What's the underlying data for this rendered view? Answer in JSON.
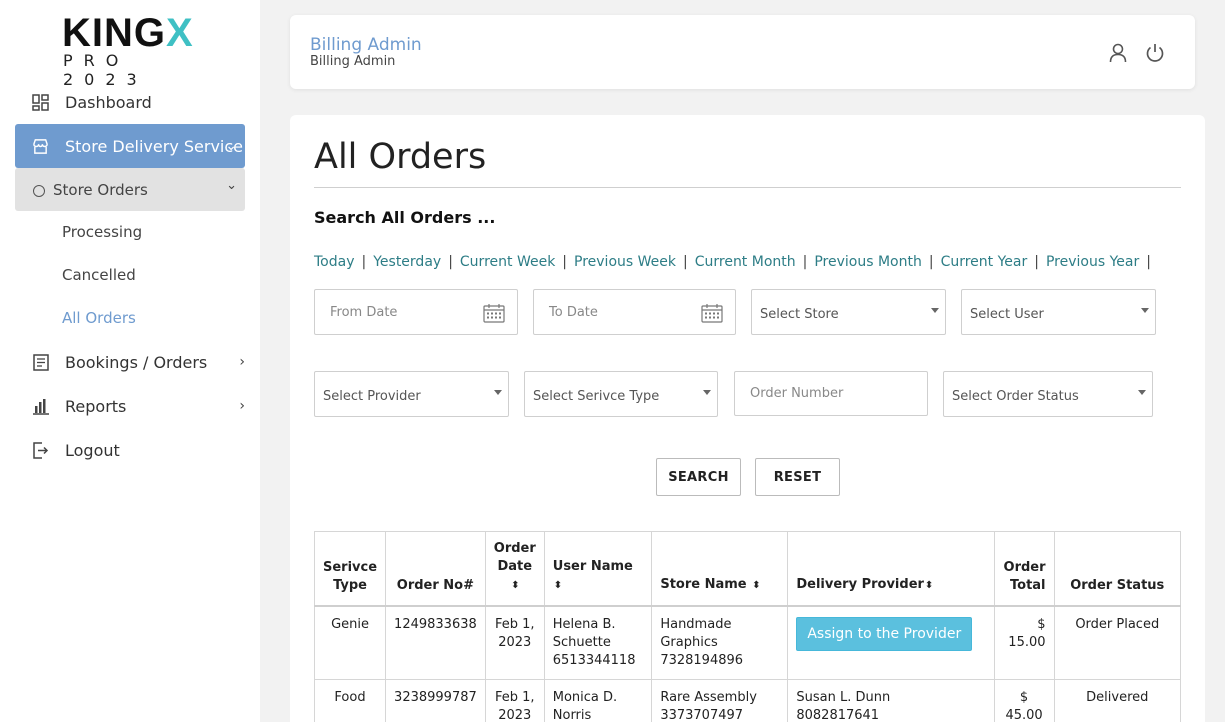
{
  "logo": {
    "main_a": "KING",
    "main_b": "X",
    "sub": "PRO 2023"
  },
  "sidebar": {
    "dashboard": "Dashboard",
    "store_delivery": "Store Delivery Service",
    "store_orders": "Store Orders",
    "sub_links": [
      "Processing",
      "Cancelled",
      "All Orders"
    ],
    "bookings": "Bookings / Orders",
    "reports": "Reports",
    "logout": "Logout"
  },
  "header": {
    "title": "Billing Admin",
    "subtitle": "Billing Admin"
  },
  "main": {
    "page_title": "All Orders",
    "search_title": "Search All Orders ...",
    "quick_filters": [
      "Today",
      "Yesterday",
      "Current Week",
      "Previous Week",
      "Current Month",
      "Previous Month",
      "Current Year",
      "Previous Year"
    ],
    "from_date_placeholder": "From Date",
    "to_date_placeholder": "To Date",
    "select_store": "Select Store",
    "select_user": "Select User",
    "select_provider": "Select Provider",
    "select_service_type": "Select Serivce Type",
    "order_number_placeholder": "Order Number",
    "select_order_status": "Select Order Status",
    "search_button": "SEARCH",
    "reset_button": "RESET"
  },
  "table": {
    "headers": {
      "service_type_1": "Serivce",
      "service_type_2": "Type",
      "order_no": "Order No#",
      "order_date_1": "Order",
      "order_date_2": "Date",
      "user_name": "User Name",
      "store_name": "Store Name",
      "delivery_provider": "Delivery Provider",
      "order_total_1": "Order",
      "order_total_2": "Total",
      "order_status": "Order Status"
    },
    "rows": [
      {
        "service_type": "Genie",
        "order_no": "1249833638",
        "date_1": "Feb 1,",
        "date_2": "2023",
        "user_1": "Helena B.",
        "user_2": "Schuette",
        "user_3": "6513344118",
        "store_1": "Handmade",
        "store_2": "Graphics",
        "store_3": "7328194896",
        "provider_button": "Assign to the Provider",
        "total": "$ 15.00",
        "status": "Order Placed"
      },
      {
        "service_type": "Food",
        "order_no": "3238999787",
        "date_1": "Feb 1,",
        "date_2": "2023",
        "user_1": "Monica D.",
        "user_2": "Norris",
        "store_1": "Rare Assembly",
        "store_2": "3373707497",
        "provider_1": "Susan L. Dunn",
        "provider_2": "8082817641",
        "total_1": "$",
        "total_2": "45.00",
        "status": "Delivered"
      }
    ]
  },
  "sort_glyph": "⬍",
  "colors": {
    "accent": "#6f9bcf",
    "link": "#2d7d86",
    "assign": "#5bc0de",
    "logo_x": "#3fc0c4"
  }
}
